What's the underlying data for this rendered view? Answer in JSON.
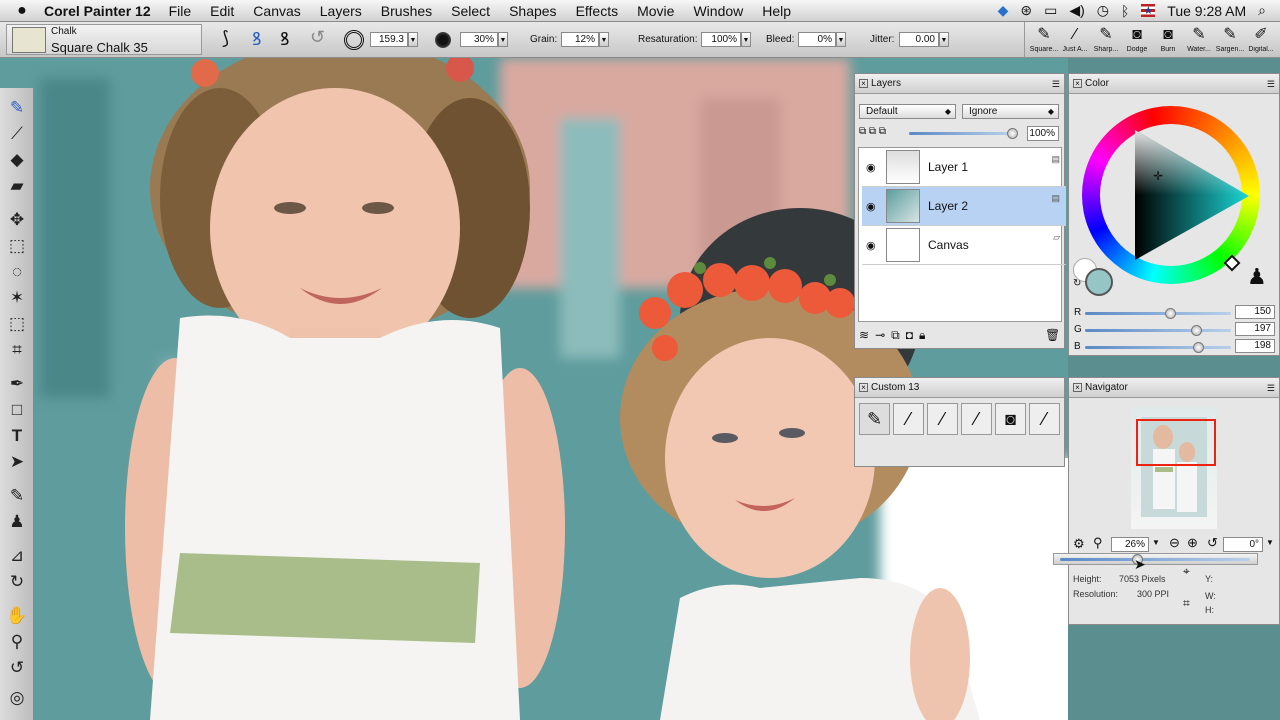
{
  "menubar": {
    "apple_icon": "",
    "app_name": "Corel Painter 12",
    "items": [
      "File",
      "Edit",
      "Canvas",
      "Layers",
      "Brushes",
      "Select",
      "Shapes",
      "Effects",
      "Movie",
      "Window",
      "Help"
    ],
    "clock": "Tue 9:28 AM"
  },
  "property_bar": {
    "brush_category": "Chalk",
    "brush_variant": "Square Chalk 35",
    "size_value": "159.3",
    "opacity_value": "30%",
    "grain_label": "Grain:",
    "grain_value": "12%",
    "resaturation_label": "Resaturation:",
    "resaturation_value": "100%",
    "bleed_label": "Bleed:",
    "bleed_value": "0%",
    "jitter_label": "Jitter:",
    "jitter_value": "0.00"
  },
  "brush_tray": {
    "items": [
      "Square...",
      "Just A...",
      "Sharp...",
      "Dodge",
      "Burn",
      "Water...",
      "Sargen...",
      "Digital..."
    ]
  },
  "layers_panel": {
    "title": "Layers",
    "composite_method": "Default",
    "composite_depth": "Ignore",
    "opacity": "100%",
    "layers": [
      {
        "name": "Layer 1",
        "selected": false
      },
      {
        "name": "Layer 2",
        "selected": true
      },
      {
        "name": "Canvas",
        "selected": false
      }
    ]
  },
  "color_panel": {
    "title": "Color",
    "r_label": "R",
    "g_label": "G",
    "b_label": "B",
    "r_value": "150",
    "g_value": "197",
    "b_value": "198",
    "current_color": "#96c5c6",
    "r_fraction": 0.59,
    "g_fraction": 0.77,
    "b_fraction": 0.78
  },
  "custom_panel": {
    "title": "Custom 13"
  },
  "navigator_panel": {
    "title": "Navigator",
    "zoom": "26%",
    "rotation": "0°",
    "height_label": "Height:",
    "height_value": "7053 Pixels",
    "resolution_label": "Resolution:",
    "resolution_value": "300 PPI",
    "y_label": "Y:",
    "w_label": "W:",
    "h_label": "H:"
  }
}
